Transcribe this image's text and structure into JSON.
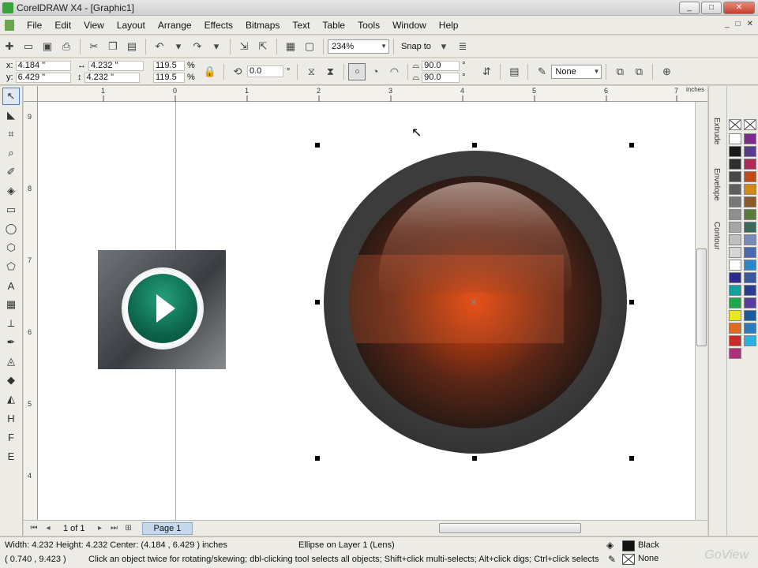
{
  "window": {
    "title": "CorelDRAW X4 - [Graphic1]",
    "buttons": [
      "_",
      "□",
      "✕"
    ]
  },
  "menu": {
    "items": [
      "File",
      "Edit",
      "View",
      "Layout",
      "Arrange",
      "Effects",
      "Bitmaps",
      "Text",
      "Table",
      "Tools",
      "Window",
      "Help"
    ],
    "right_buttons": [
      "_",
      "□",
      "✕"
    ]
  },
  "standard_toolbar": {
    "zoom_level": "234%",
    "snap_label": "Snap to"
  },
  "property_bar": {
    "x_label": "x:",
    "x_value": "4.184 \"",
    "y_label": "y:",
    "y_value": "6.429 \"",
    "width_value": "4.232 \"",
    "height_value": "4.232 \"",
    "scale_x": "119.5",
    "scale_y": "119.5",
    "percent": "%",
    "rotation": "0.0",
    "degree": "°",
    "start_angle": "90.0",
    "end_angle": "90.0",
    "outline": "None"
  },
  "rulers": {
    "unit": "inches",
    "top_labels": [
      "1",
      "0",
      "1",
      "2",
      "3",
      "4",
      "5",
      "6",
      "7"
    ],
    "left_labels": [
      "9",
      "8",
      "7",
      "6",
      "5",
      "4"
    ]
  },
  "pager": {
    "count": "1 of 1",
    "page_tab": "Page 1"
  },
  "dockers": [
    "Extrude",
    "Envelope",
    "Contour"
  ],
  "palette": {
    "colors": [
      "#ffffff",
      "#1a1a1a",
      "#2f2f2f",
      "#474747",
      "#5f5f5f",
      "#777777",
      "#8f8f8f",
      "#a7a7a7",
      "#bfbfbf",
      "#d7d7d7",
      "#ffffff",
      "#2c2c8c",
      "#15a0a0",
      "#1ea84a",
      "#e8e81a",
      "#e06a1e",
      "#c82a2a",
      "#b0307c",
      "#7c2c8c",
      "#5a3a8a",
      "#b02a58",
      "#c04a1a",
      "#d08a1a",
      "#8a5a2a",
      "#5a7a3a",
      "#3a6a5a",
      "#7a8ab8",
      "#4a6ab0",
      "#2a86c8",
      "#3a5aa0",
      "#2c3c90",
      "#5a3c9c",
      "#1a5a9c",
      "#2a7ac0",
      "#2ab0e0"
    ]
  },
  "status": {
    "dimensions": "Width: 4.232  Height: 4.232  Center: (4.184 , 6.429 )  inches",
    "object_info": "Ellipse on Layer 1  (Lens)",
    "cursor_pos": "( 0.740 , 9.423 )",
    "hint": "Click an object twice for rotating/skewing; dbl-clicking tool selects all objects; Shift+click multi-selects; Alt+click digs; Ctrl+click selects in a group",
    "fill_label": "Black",
    "outline_label": "None",
    "fill_color": "#111111"
  },
  "watermark": "GoView"
}
